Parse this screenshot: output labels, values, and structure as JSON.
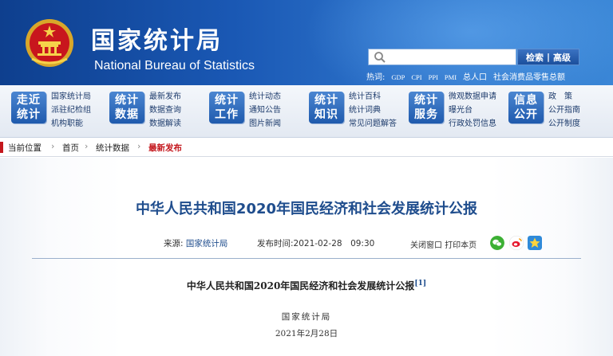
{
  "header": {
    "title_cn": "国家统计局",
    "title_en": "National Bureau of Statistics",
    "search": {
      "placeholder": "",
      "buttons": [
        "检索",
        "高级"
      ]
    },
    "quick_links": [
      "热词:",
      "GDP",
      "CPI",
      "PPI",
      "PMI",
      "总人口",
      "社会消费品零售总额"
    ]
  },
  "nav": [
    {
      "badge": [
        "走近",
        "统计"
      ],
      "links": [
        "国家统计局",
        "派驻纪检组",
        "机构职能"
      ]
    },
    {
      "badge": [
        "统计",
        "数据"
      ],
      "links": [
        "最新发布",
        "数据查询",
        "数据解读"
      ]
    },
    {
      "badge": [
        "统计",
        "工作"
      ],
      "links": [
        "统计动态",
        "通知公告",
        "图片新闻"
      ]
    },
    {
      "badge": [
        "统计",
        "知识"
      ],
      "links": [
        "统计百科",
        "统计词典",
        "常见问题解答"
      ]
    },
    {
      "badge": [
        "统计",
        "服务"
      ],
      "links": [
        "微观数据申请",
        "曝光台",
        "行政处罚信息"
      ]
    },
    {
      "badge": [
        "信息",
        "公开"
      ],
      "links": [
        "政　策",
        "公开指南",
        "公开制度"
      ]
    }
  ],
  "breadcrumb": {
    "items": [
      "当前位置",
      "首页",
      "统计数据"
    ],
    "current": "最新发布"
  },
  "article": {
    "title": "中华人民共和国2020年国民经济和社会发展统计公报",
    "source_label": "来源:",
    "source": "国家统计局",
    "date_label": "发布时间:",
    "date": "2021-02-28　09:30",
    "tools": [
      "关闭窗口",
      "打印本页"
    ],
    "share_icons": [
      "wechat-icon",
      "weibo-icon",
      "qzone-icon"
    ],
    "doc_title": "中华人民共和国2020年国民经济和社会发展统计公报",
    "doc_footnote": "[1]",
    "doc_org": "国家统计局",
    "doc_date": "2021年2月28日"
  },
  "colors": {
    "banner": "#1a58b4",
    "nav_badge": "#1f5aad",
    "title": "#1f4d8d",
    "accent_red": "#c4171d"
  }
}
